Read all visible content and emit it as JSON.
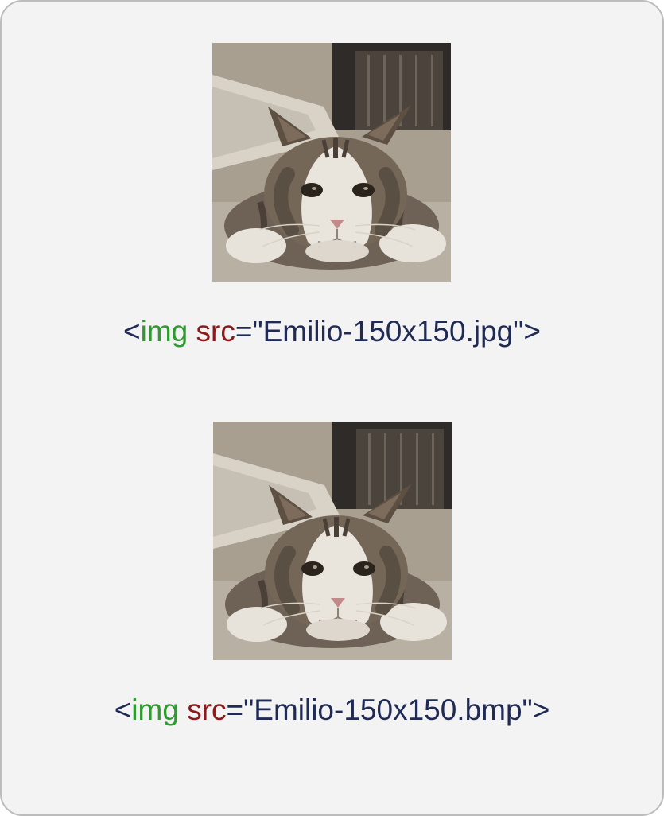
{
  "examples": [
    {
      "tag_open": "<",
      "tag_name": "img",
      "space": " ",
      "attr_name": "src",
      "equals": "=",
      "attr_value": "\"Emilio-150x150.jpg\"",
      "tag_close": ">"
    },
    {
      "tag_open": "<",
      "tag_name": "img",
      "space": " ",
      "attr_name": "src",
      "equals": "=",
      "attr_value": "\"Emilio-150x150.bmp\"",
      "tag_close": ">"
    }
  ]
}
